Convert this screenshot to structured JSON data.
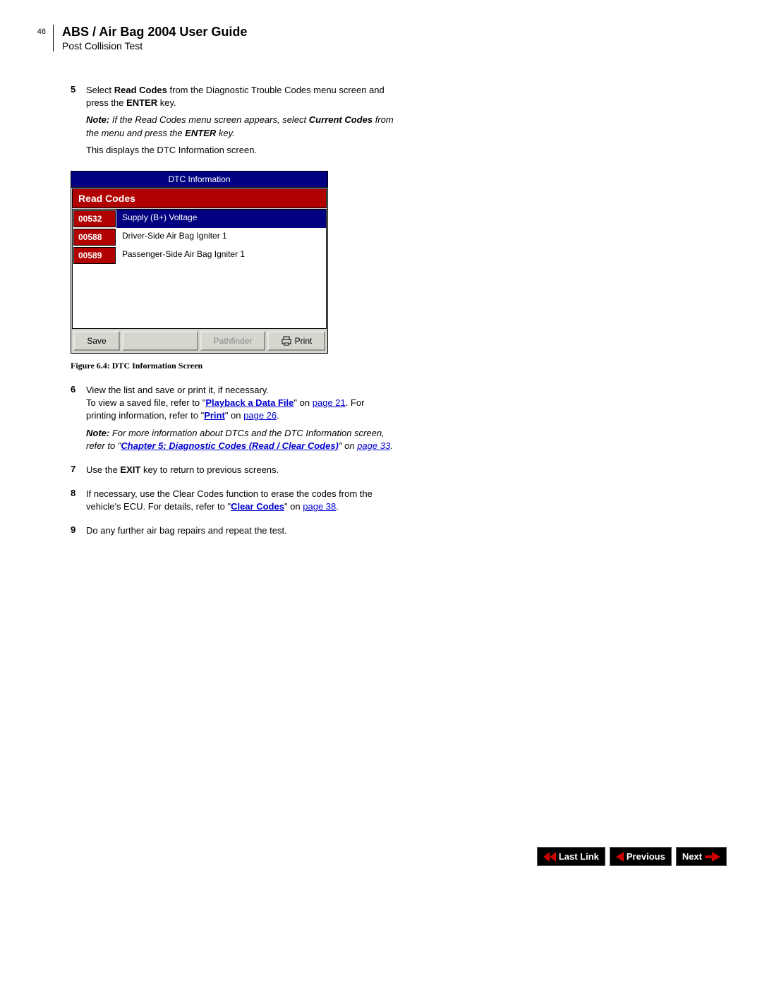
{
  "header": {
    "page_num": "46",
    "title": "ABS / Air Bag 2004 User Guide",
    "subtitle": "Post Collision Test"
  },
  "steps": {
    "s5": {
      "num": "5",
      "p1a": "Select ",
      "p1b": "Read Codes",
      "p1c": " from the Diagnostic Trouble Codes menu screen and press the ",
      "p1d": "ENTER",
      "p1e": " key.",
      "note_label": "Note:  ",
      "note_a": "If the Read Codes menu screen appears, select ",
      "note_b": "Current Codes",
      "note_c": " from the menu and press the ",
      "note_d": "ENTER",
      "note_e": " key.",
      "p3": "This displays the DTC Information screen."
    },
    "s6": {
      "num": "6",
      "p1": "View the list and save or print it, if necessary.",
      "p2a": "To view a saved file, refer to \"",
      "p2link1": "Playback a Data File",
      "p2b": "\" on ",
      "p2link2": "page 21",
      "p2c": ". For printing information, refer to \"",
      "p2link3": "Print",
      "p2d": "\" on ",
      "p2link4": "page 26",
      "p2e": ".",
      "note_label": "Note:  ",
      "note_a": "For more information about DTCs and the DTC Information screen, refer to \"",
      "note_link": "Chapter 5: Diagnostic Codes (Read / Clear Codes)",
      "note_b": "\" on ",
      "note_link2": "page 33",
      "note_c": "."
    },
    "s7": {
      "num": "7",
      "a": "Use the ",
      "b": "EXIT",
      "c": " key to return to previous screens."
    },
    "s8": {
      "num": "8",
      "a": "If necessary, use the Clear Codes function to erase the codes from the vehicle's ECU. For details, refer to \"",
      "link1": "Clear Codes",
      "b": "\" on ",
      "link2": "page 38",
      "c": "."
    },
    "s9": {
      "num": "9",
      "a": "Do any further air bag repairs and repeat the test."
    }
  },
  "screen": {
    "title": "DTC Information",
    "subtitle": "Read Codes",
    "rows": [
      {
        "code": "00532",
        "desc": "Supply (B+) Voltage",
        "selected": true
      },
      {
        "code": "00588",
        "desc": "Driver-Side Air Bag Igniter 1",
        "selected": false
      },
      {
        "code": "00589",
        "desc": "Passenger-Side Air Bag Igniter 1",
        "selected": false
      }
    ],
    "buttons": {
      "save": "Save",
      "pathfinder": "Pathfinder",
      "print": "Print"
    }
  },
  "figure_caption": "Figure 6.4: DTC Information Screen",
  "nav": {
    "last_link": "Last Link",
    "previous": "Previous",
    "next": "Next"
  }
}
